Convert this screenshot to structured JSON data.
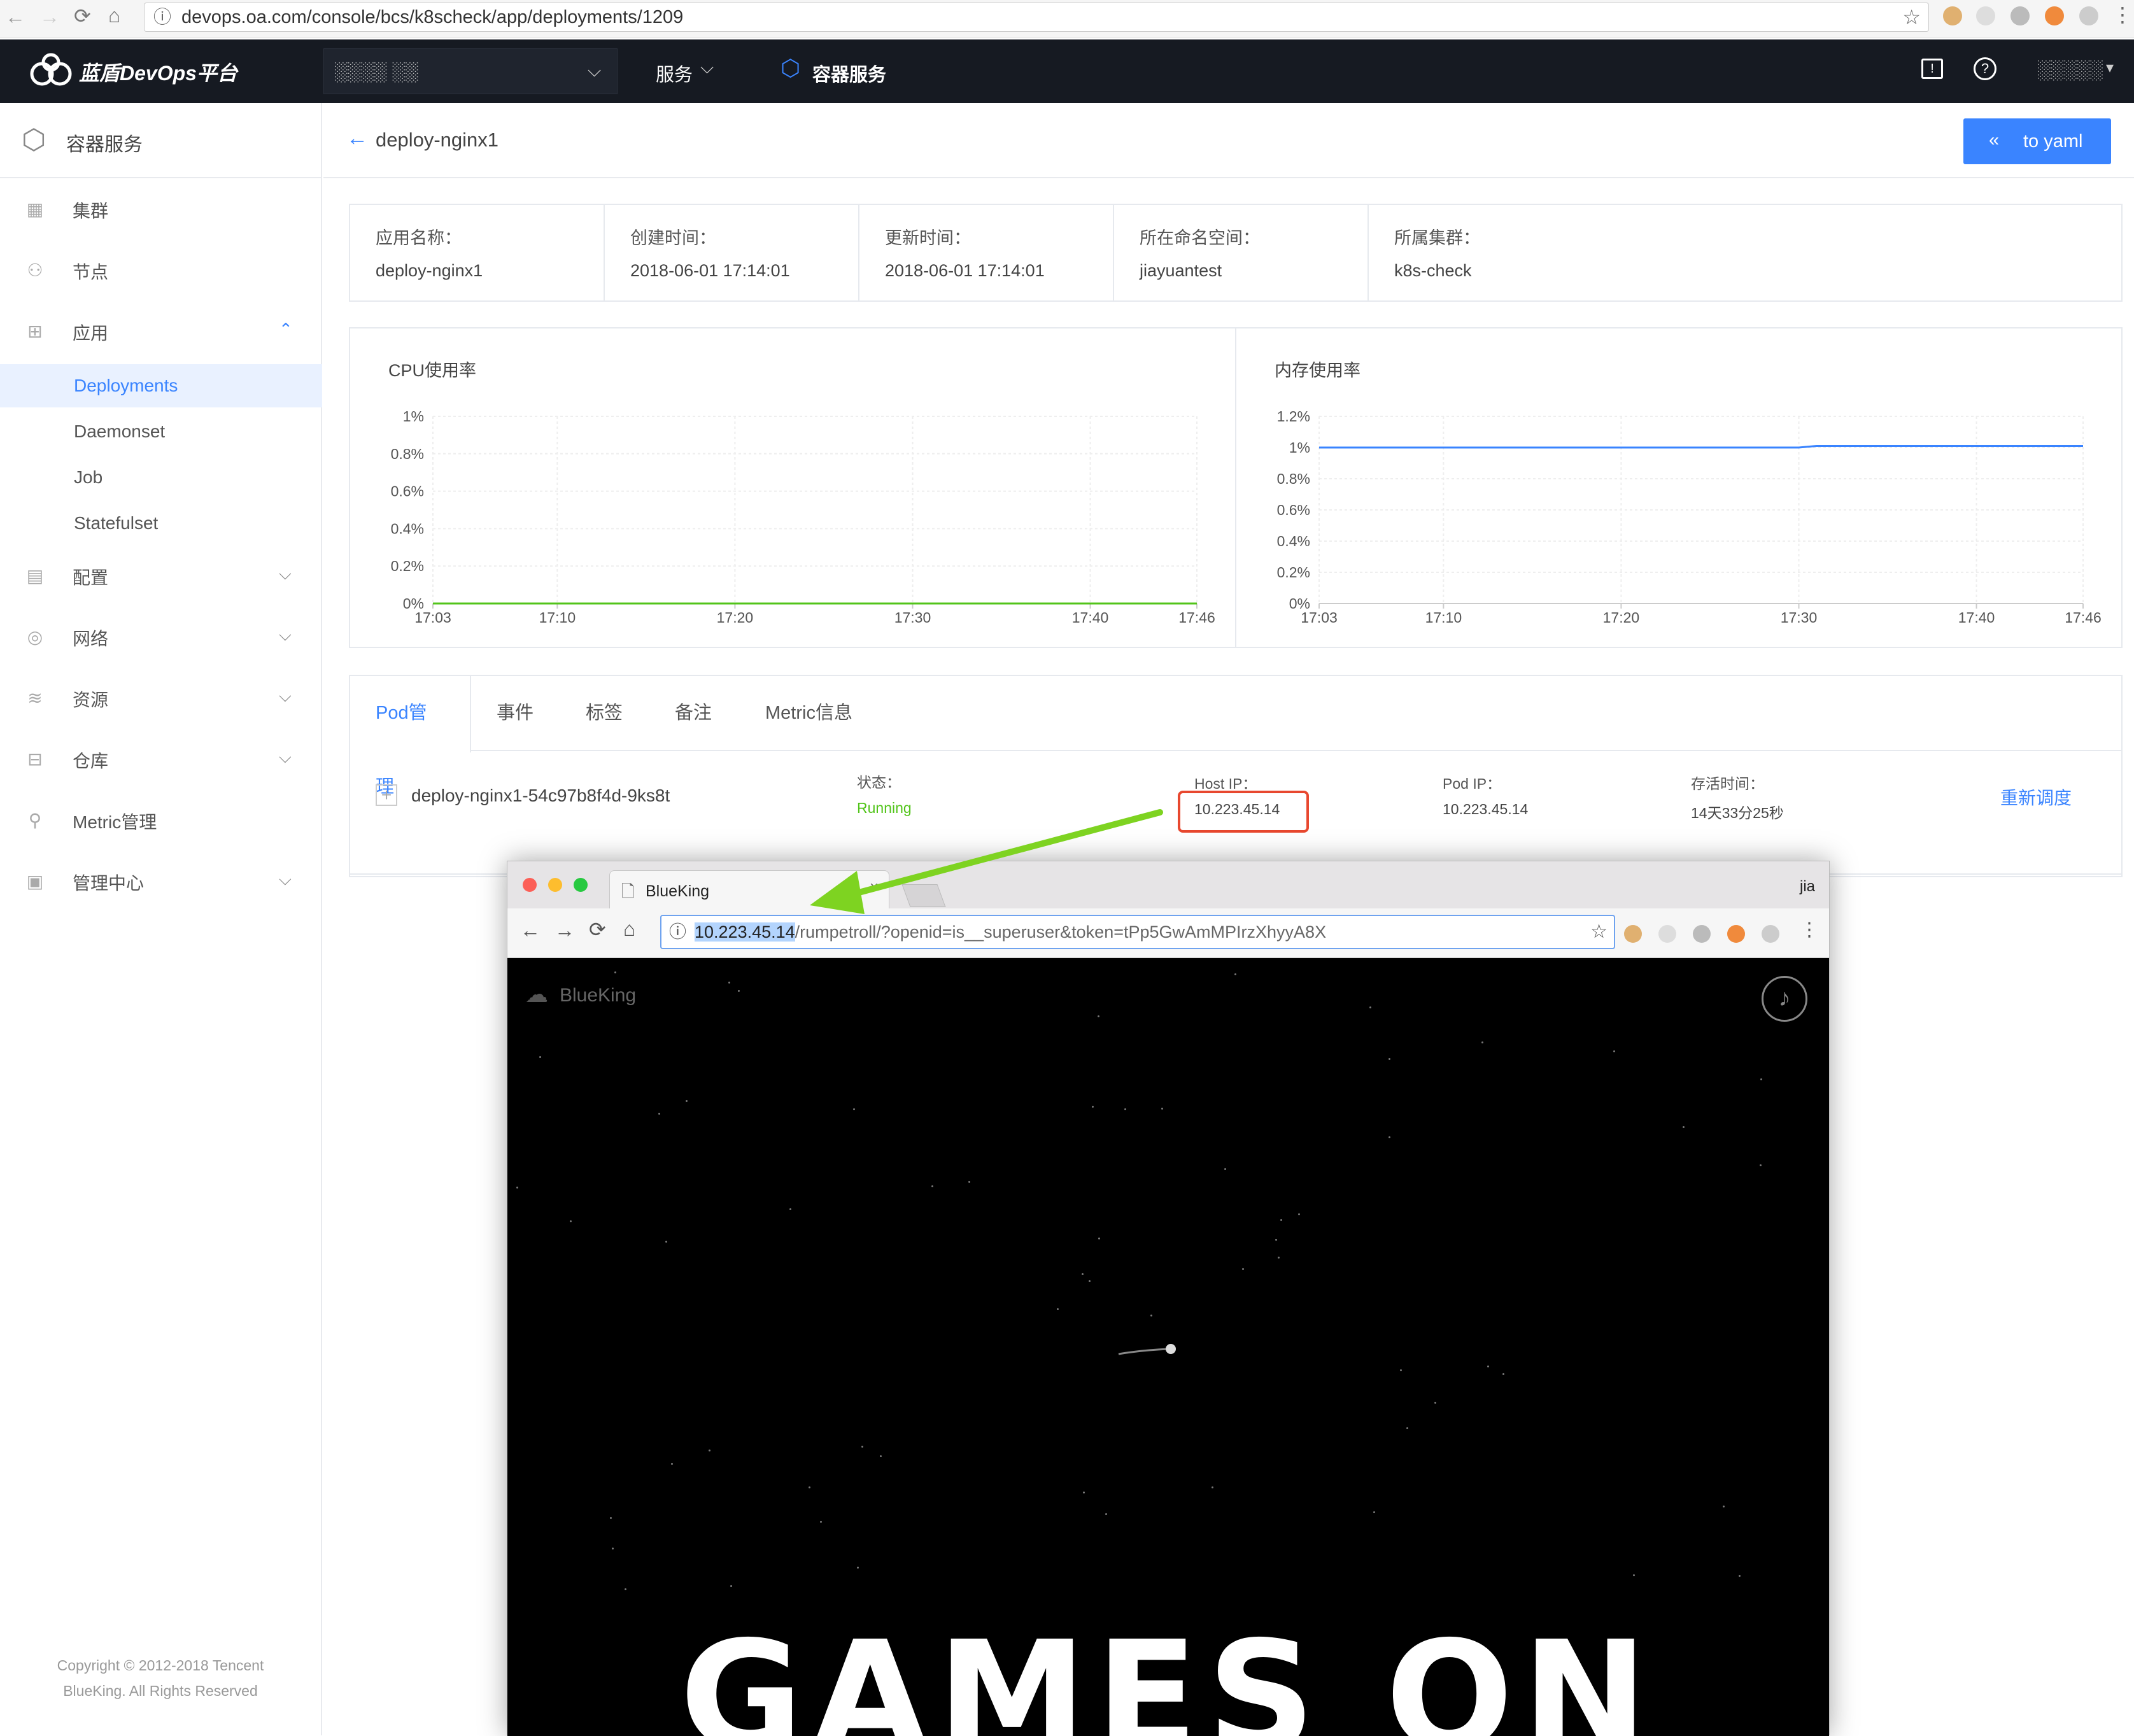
{
  "browser": {
    "url": "devops.oa.com/console/bcs/k8scheck/app/deployments/1209"
  },
  "topnav": {
    "brand": "蓝盾DevOps平台",
    "project": "░░░░ ░░",
    "services": "服务",
    "container_service": "容器服务",
    "user": "░░░░░"
  },
  "sidebar": {
    "header": "容器服务",
    "items": [
      {
        "label": "集群",
        "icon": "cluster-icon"
      },
      {
        "label": "节点",
        "icon": "node-icon"
      },
      {
        "label": "应用",
        "icon": "app-icon"
      },
      {
        "label": "配置",
        "icon": "config-icon"
      },
      {
        "label": "网络",
        "icon": "network-icon"
      },
      {
        "label": "资源",
        "icon": "resource-icon"
      },
      {
        "label": "仓库",
        "icon": "repository-icon"
      },
      {
        "label": "Metric管理",
        "icon": "metric-icon"
      },
      {
        "label": "管理中心",
        "icon": "admin-icon"
      }
    ],
    "subitems": [
      "Deployments",
      "Daemonset",
      "Job",
      "Statefulset"
    ],
    "copyright1": "Copyright © 2012-2018 Tencent",
    "copyright2": "BlueKing. All Rights Reserved"
  },
  "header": {
    "title": "deploy-nginx1",
    "to_yaml": "to yaml"
  },
  "info": {
    "app_name_label": "应用名称：",
    "app_name": "deploy-nginx1",
    "created_label": "创建时间：",
    "created": "2018-06-01 17:14:01",
    "updated_label": "更新时间：",
    "updated": "2018-06-01 17:14:01",
    "namespace_label": "所在命名空间：",
    "namespace": "jiayuantest",
    "cluster_label": "所属集群：",
    "cluster": "k8s-check"
  },
  "chart_data": [
    {
      "type": "line",
      "title": "CPU使用率",
      "x_ticks": [
        "17:03",
        "17:10",
        "17:20",
        "17:30",
        "17:40",
        "17:46"
      ],
      "y_ticks": [
        "1%",
        "0.8%",
        "0.6%",
        "0.4%",
        "0.2%",
        "0%"
      ],
      "ylim": [
        0,
        1
      ],
      "series": [
        {
          "color": "#52c41a",
          "x": [
            "17:03",
            "17:46"
          ],
          "y": [
            0,
            0
          ]
        }
      ]
    },
    {
      "type": "line",
      "title": "内存使用率",
      "x_ticks": [
        "17:03",
        "17:10",
        "17:20",
        "17:30",
        "17:40",
        "17:46"
      ],
      "y_ticks": [
        "1.2%",
        "1%",
        "0.8%",
        "0.6%",
        "0.4%",
        "0.2%",
        "0%"
      ],
      "ylim": [
        0,
        1.2
      ],
      "series": [
        {
          "color": "#3a84ff",
          "x": [
            "17:03",
            "17:30",
            "17:31",
            "17:46"
          ],
          "y": [
            1.0,
            1.0,
            1.01,
            1.01
          ]
        }
      ]
    }
  ],
  "tabs": [
    "Pod管理",
    "事件",
    "标签",
    "备注",
    "Metric信息"
  ],
  "pod": {
    "name": "deploy-nginx1-54c97b8f4d-9ks8t",
    "status_label": "状态：",
    "status": "Running",
    "host_ip_label": "Host IP：",
    "host_ip": "10.223.45.14",
    "pod_ip_label": "Pod IP：",
    "pod_ip": "10.223.45.14",
    "uptime_label": "存活时间：",
    "uptime": "14天33分25秒",
    "action": "重新调度"
  },
  "inner_browser": {
    "tab_title": "BlueKing",
    "user": "jia",
    "url_host": "10.223.45.14",
    "url_path": "/rumpetroll/?openid=is__superuser&token=tPp5GwAmMPIrzXhyyA8X",
    "logo": "BlueKing",
    "banner": "GAMES ON"
  },
  "colors": {
    "accent": "#3a84ff",
    "nav_bg": "#161a22",
    "running": "#52c41a",
    "highlight_box": "#e8482f",
    "arrow": "#7ed321"
  }
}
